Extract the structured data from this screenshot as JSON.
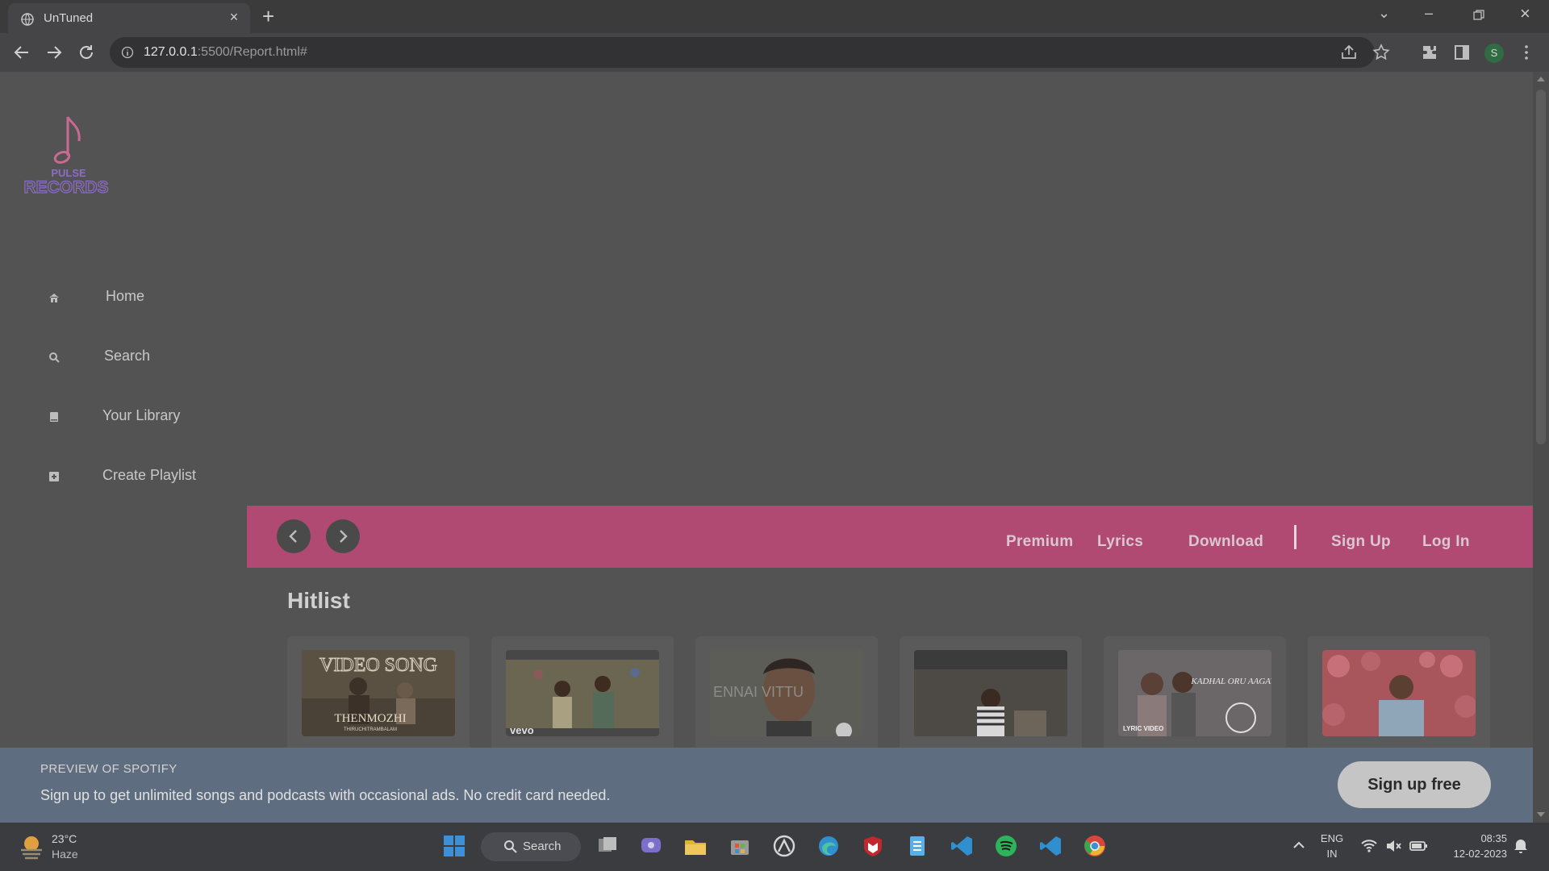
{
  "browser": {
    "tab_title": "UnTuned",
    "url_host": "127.0.0.1",
    "url_rest": ":5500/Report.html#",
    "profile_initial": "S"
  },
  "logo": {
    "line1": "PULSE",
    "line2": "RECORDS"
  },
  "sidebar": {
    "items": [
      {
        "label": "Home",
        "icon": "home-icon"
      },
      {
        "label": "Search",
        "icon": "search-icon"
      },
      {
        "label": "Your Library",
        "icon": "book-icon"
      },
      {
        "label": "Create Playlist",
        "icon": "plus-square-icon"
      }
    ]
  },
  "topbar": {
    "links": [
      "Premium",
      "Lyrics",
      "Download",
      "Sign Up",
      "Log In"
    ]
  },
  "section": {
    "title": "Hitlist"
  },
  "cards": [
    {
      "caption_top": "VIDEO SONG",
      "caption_main": "THENMOZHI",
      "caption_sub": "THIRUCHITRAMBALAM"
    },
    {
      "badge": "vevo"
    },
    {
      "caption_main": "ENNAI VITTU"
    },
    {},
    {
      "caption_main": "KADHAL ORU AAGAYAM",
      "badge": "LYRIC VIDEO"
    },
    {}
  ],
  "banner": {
    "kicker": "PREVIEW OF SPOTIFY",
    "message": "Sign up to get unlimited songs and podcasts with occasional ads. No credit card needed.",
    "button": "Sign up free"
  },
  "taskbar": {
    "temp": "23°C",
    "condition": "Haze",
    "search": "Search",
    "lang1": "ENG",
    "lang2": "IN",
    "time": "08:35",
    "date": "12-02-2023"
  },
  "colors": {
    "accent": "#b14a72",
    "page_bg": "#535353",
    "banner_bg": "#5f6d80"
  }
}
